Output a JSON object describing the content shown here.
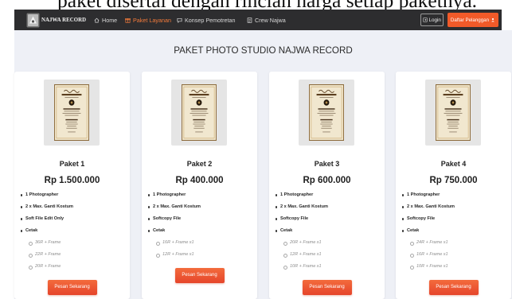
{
  "caption": "paket disertai dengan rincian harga setiap paketnya.",
  "navbar": {
    "brand": "NAJWA RECORD",
    "logo_icon": "logo-icon",
    "items": [
      {
        "label": "Home",
        "icon": "home-icon",
        "active": false
      },
      {
        "label": "Paket Layanan",
        "icon": "box-icon",
        "active": true
      },
      {
        "label": "Konsep Pemotretan",
        "icon": "chat-icon",
        "active": false
      },
      {
        "label": "Crew Najwa",
        "icon": "list-icon",
        "active": false
      }
    ],
    "login": {
      "label": "Login",
      "icon": "login-icon"
    },
    "register": {
      "label": "Daftar Pelanggan",
      "icon": "user-icon"
    }
  },
  "main": {
    "title": "PAKET PHOTO STUDIO NAJWA RECORD",
    "packages": [
      {
        "name": "Paket 1",
        "price": "Rp 1.500.000",
        "features": [
          "1 Photographer",
          "2 x Max. Ganti Kostum",
          "Soft File Edit Only",
          "Cetak"
        ],
        "prints": [
          "36R + Frame",
          "22R + Frame",
          "20R + Frame"
        ],
        "button": "Pesan Sekarang"
      },
      {
        "name": "Paket 2",
        "price": "Rp 400.000",
        "features": [
          "1 Photographer",
          "2 x Max. Ganti Kostum",
          "Softcopy File",
          "Cetak"
        ],
        "prints": [
          "16R + Frame x1",
          "12R + Frame x1"
        ],
        "button": "Pesan Sekarang"
      },
      {
        "name": "Paket 3",
        "price": "Rp 600.000",
        "features": [
          "1 Photographer",
          "2 x Max. Ganti Kostum",
          "Softcopy File",
          "Cetak"
        ],
        "prints": [
          "20R + Frame x1",
          "12R + Frame x1",
          "10R + Frame x1"
        ],
        "button": "Pesan Sekarang"
      },
      {
        "name": "Paket 4",
        "price": "Rp 750.000",
        "features": [
          "1 Photographer",
          "2 x Max. Ganti Kostum",
          "Softcopy File",
          "Cetak"
        ],
        "prints": [
          "24R + Frame x1",
          "16R + Frame x1",
          "10R + Frame x1"
        ],
        "button": "Pesan Sekarang"
      }
    ]
  },
  "colors": {
    "navbar_bg": "#2d2d2f",
    "accent": "#f15a29",
    "active_nav": "#f47b3b",
    "page_bg": "#eef0f6",
    "card_bg": "#ffffff",
    "muted_text": "#8c8c8c"
  }
}
